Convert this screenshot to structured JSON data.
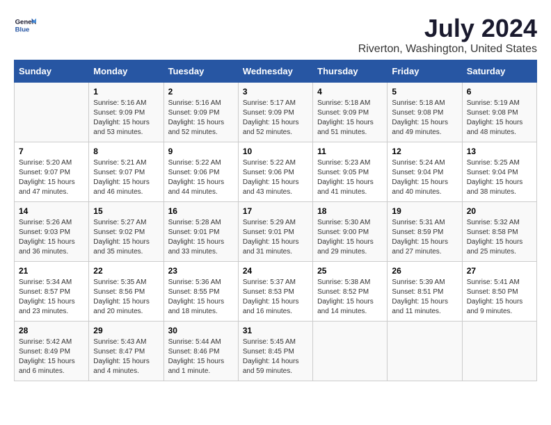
{
  "header": {
    "logo_line1": "General",
    "logo_line2": "Blue",
    "title": "July 2024",
    "subtitle": "Riverton, Washington, United States"
  },
  "days_of_week": [
    "Sunday",
    "Monday",
    "Tuesday",
    "Wednesday",
    "Thursday",
    "Friday",
    "Saturday"
  ],
  "weeks": [
    [
      {
        "day": "",
        "info": ""
      },
      {
        "day": "1",
        "info": "Sunrise: 5:16 AM\nSunset: 9:09 PM\nDaylight: 15 hours\nand 53 minutes."
      },
      {
        "day": "2",
        "info": "Sunrise: 5:16 AM\nSunset: 9:09 PM\nDaylight: 15 hours\nand 52 minutes."
      },
      {
        "day": "3",
        "info": "Sunrise: 5:17 AM\nSunset: 9:09 PM\nDaylight: 15 hours\nand 52 minutes."
      },
      {
        "day": "4",
        "info": "Sunrise: 5:18 AM\nSunset: 9:09 PM\nDaylight: 15 hours\nand 51 minutes."
      },
      {
        "day": "5",
        "info": "Sunrise: 5:18 AM\nSunset: 9:08 PM\nDaylight: 15 hours\nand 49 minutes."
      },
      {
        "day": "6",
        "info": "Sunrise: 5:19 AM\nSunset: 9:08 PM\nDaylight: 15 hours\nand 48 minutes."
      }
    ],
    [
      {
        "day": "7",
        "info": "Sunrise: 5:20 AM\nSunset: 9:07 PM\nDaylight: 15 hours\nand 47 minutes."
      },
      {
        "day": "8",
        "info": "Sunrise: 5:21 AM\nSunset: 9:07 PM\nDaylight: 15 hours\nand 46 minutes."
      },
      {
        "day": "9",
        "info": "Sunrise: 5:22 AM\nSunset: 9:06 PM\nDaylight: 15 hours\nand 44 minutes."
      },
      {
        "day": "10",
        "info": "Sunrise: 5:22 AM\nSunset: 9:06 PM\nDaylight: 15 hours\nand 43 minutes."
      },
      {
        "day": "11",
        "info": "Sunrise: 5:23 AM\nSunset: 9:05 PM\nDaylight: 15 hours\nand 41 minutes."
      },
      {
        "day": "12",
        "info": "Sunrise: 5:24 AM\nSunset: 9:04 PM\nDaylight: 15 hours\nand 40 minutes."
      },
      {
        "day": "13",
        "info": "Sunrise: 5:25 AM\nSunset: 9:04 PM\nDaylight: 15 hours\nand 38 minutes."
      }
    ],
    [
      {
        "day": "14",
        "info": "Sunrise: 5:26 AM\nSunset: 9:03 PM\nDaylight: 15 hours\nand 36 minutes."
      },
      {
        "day": "15",
        "info": "Sunrise: 5:27 AM\nSunset: 9:02 PM\nDaylight: 15 hours\nand 35 minutes."
      },
      {
        "day": "16",
        "info": "Sunrise: 5:28 AM\nSunset: 9:01 PM\nDaylight: 15 hours\nand 33 minutes."
      },
      {
        "day": "17",
        "info": "Sunrise: 5:29 AM\nSunset: 9:01 PM\nDaylight: 15 hours\nand 31 minutes."
      },
      {
        "day": "18",
        "info": "Sunrise: 5:30 AM\nSunset: 9:00 PM\nDaylight: 15 hours\nand 29 minutes."
      },
      {
        "day": "19",
        "info": "Sunrise: 5:31 AM\nSunset: 8:59 PM\nDaylight: 15 hours\nand 27 minutes."
      },
      {
        "day": "20",
        "info": "Sunrise: 5:32 AM\nSunset: 8:58 PM\nDaylight: 15 hours\nand 25 minutes."
      }
    ],
    [
      {
        "day": "21",
        "info": "Sunrise: 5:34 AM\nSunset: 8:57 PM\nDaylight: 15 hours\nand 23 minutes."
      },
      {
        "day": "22",
        "info": "Sunrise: 5:35 AM\nSunset: 8:56 PM\nDaylight: 15 hours\nand 20 minutes."
      },
      {
        "day": "23",
        "info": "Sunrise: 5:36 AM\nSunset: 8:55 PM\nDaylight: 15 hours\nand 18 minutes."
      },
      {
        "day": "24",
        "info": "Sunrise: 5:37 AM\nSunset: 8:53 PM\nDaylight: 15 hours\nand 16 minutes."
      },
      {
        "day": "25",
        "info": "Sunrise: 5:38 AM\nSunset: 8:52 PM\nDaylight: 15 hours\nand 14 minutes."
      },
      {
        "day": "26",
        "info": "Sunrise: 5:39 AM\nSunset: 8:51 PM\nDaylight: 15 hours\nand 11 minutes."
      },
      {
        "day": "27",
        "info": "Sunrise: 5:41 AM\nSunset: 8:50 PM\nDaylight: 15 hours\nand 9 minutes."
      }
    ],
    [
      {
        "day": "28",
        "info": "Sunrise: 5:42 AM\nSunset: 8:49 PM\nDaylight: 15 hours\nand 6 minutes."
      },
      {
        "day": "29",
        "info": "Sunrise: 5:43 AM\nSunset: 8:47 PM\nDaylight: 15 hours\nand 4 minutes."
      },
      {
        "day": "30",
        "info": "Sunrise: 5:44 AM\nSunset: 8:46 PM\nDaylight: 15 hours\nand 1 minute."
      },
      {
        "day": "31",
        "info": "Sunrise: 5:45 AM\nSunset: 8:45 PM\nDaylight: 14 hours\nand 59 minutes."
      },
      {
        "day": "",
        "info": ""
      },
      {
        "day": "",
        "info": ""
      },
      {
        "day": "",
        "info": ""
      }
    ]
  ]
}
